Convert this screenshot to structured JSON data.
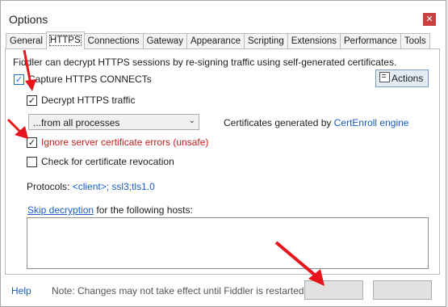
{
  "window": {
    "title": "Options",
    "close_icon": "close-icon"
  },
  "tabs": [
    {
      "label": "General"
    },
    {
      "label": "HTTPS"
    },
    {
      "label": "Connections"
    },
    {
      "label": "Gateway"
    },
    {
      "label": "Appearance"
    },
    {
      "label": "Scripting"
    },
    {
      "label": "Extensions"
    },
    {
      "label": "Performance"
    },
    {
      "label": "Tools"
    }
  ],
  "https": {
    "intro": "Fiddler can decrypt HTTPS sessions by re-signing traffic using self-generated certificates.",
    "capture_label": "Capture HTTPS CONNECTs",
    "capture_checked": true,
    "decrypt_label": "Decrypt HTTPS traffic",
    "decrypt_checked": true,
    "process_filter": "...from all processes",
    "certs_prefix": "Certificates generated by",
    "certs_engine": "CertEnroll engine",
    "ignore_label": "Ignore server certificate errors (unsafe)",
    "ignore_checked": true,
    "revocation_label": "Check for certificate revocation",
    "revocation_checked": false,
    "protocols_label": "Protocols:",
    "protocols_value": "<client>; ssl3;tls1.0",
    "skip_link": "Skip decryption",
    "skip_suffix": "for the following hosts:",
    "hosts_value": "",
    "actions_label": "Actions"
  },
  "footer": {
    "help": "Help",
    "note": "Note: Changes may not take effect until Fiddler is restarted.",
    "ok_label": "",
    "cancel_label": ""
  },
  "colors": {
    "annotation_arrow": "#e8141c",
    "link": "#1b5bc7",
    "warning_text": "#c62020"
  }
}
